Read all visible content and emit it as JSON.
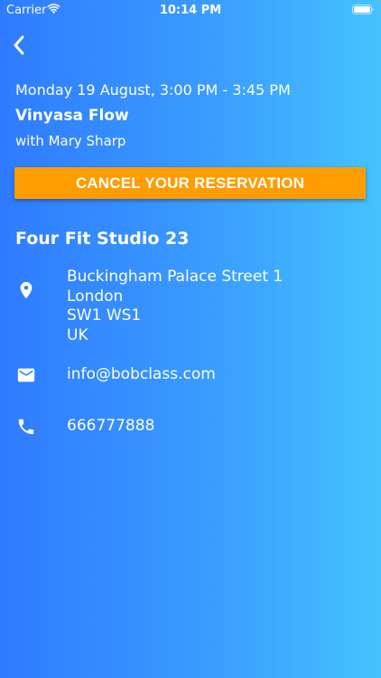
{
  "status_bar": {
    "carrier": "Carrier",
    "time": "10:14 PM"
  },
  "booking": {
    "date_time": "Monday 19 August, 3:00 PM - 3:45 PM",
    "class_name": "Vinyasa Flow",
    "instructor": "with Mary Sharp",
    "cancel_label": "CANCEL YOUR RESERVATION"
  },
  "studio": {
    "name": "Four Fit Studio 23",
    "address_lines": [
      "Buckingham Palace Street 1",
      "London",
      "SW1 WS1",
      "UK"
    ],
    "email": "info@bobclass.com",
    "phone": "666777888"
  },
  "icons": {
    "back": "chevron-left-icon",
    "location": "location-pin-icon",
    "email": "mail-icon",
    "phone": "phone-icon",
    "wifi": "wifi-icon",
    "battery": "battery-icon"
  },
  "colors": {
    "background_start": "#2f7bff",
    "background_end": "#45c3ff",
    "cancel_button": "#ff9c00",
    "text": "#ffffff"
  }
}
